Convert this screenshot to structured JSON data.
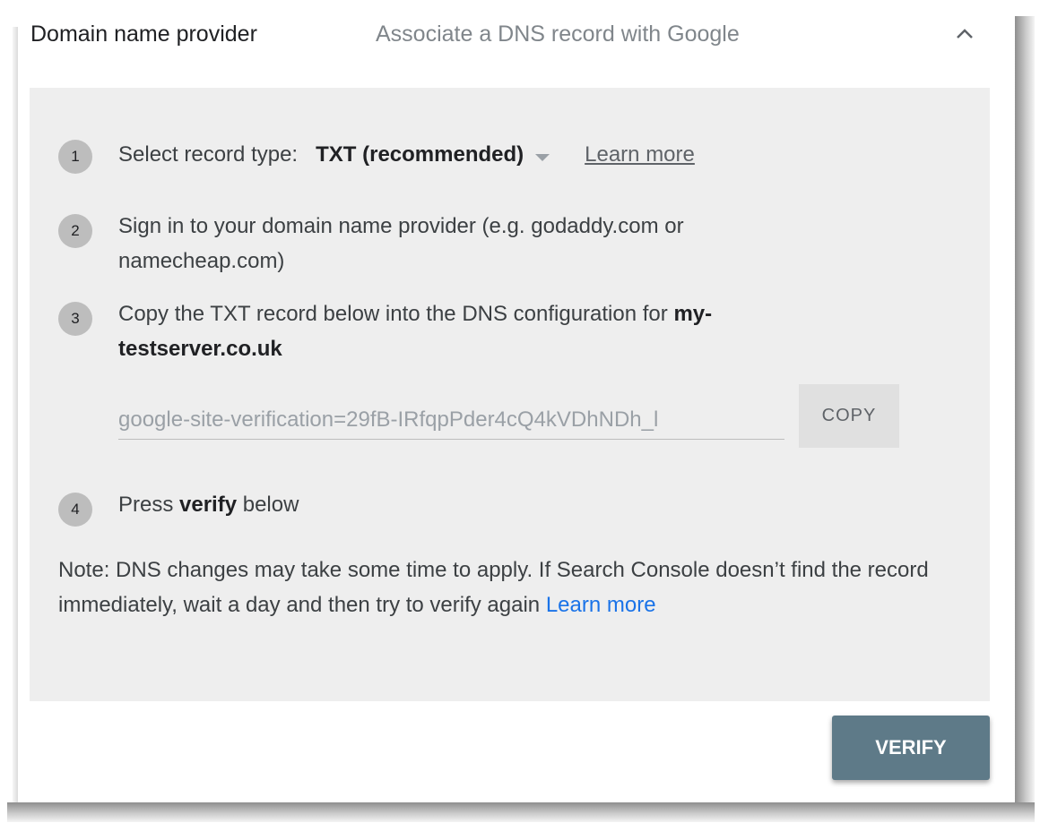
{
  "header": {
    "title": "Domain name provider",
    "subtitle": "Associate a DNS record with Google",
    "collapse_icon": "chevron-up-icon"
  },
  "steps": [
    {
      "number": "1",
      "label": "Select record type:",
      "record_type": "TXT (recommended)",
      "learn_more": "Learn more"
    },
    {
      "number": "2",
      "text": "Sign in to your domain name provider (e.g. godaddy.com or namecheap.com)"
    },
    {
      "number": "3",
      "text": "Copy the TXT record below into the DNS configuration for ",
      "domain": "my-testserver.co.uk"
    },
    {
      "number": "4",
      "text_before": "Press ",
      "text_bold": "verify",
      "text_after": " below"
    }
  ],
  "txt_record": {
    "value": "google-site-verification=29fB-IRfqpPder4cQ4kVDhNDh_l",
    "copy_label": "COPY"
  },
  "note": {
    "text": "Note: DNS changes may take some time to apply. If Search Console doesn’t find the record immediately, wait a day and then try to verify again ",
    "link": "Learn more"
  },
  "verify_label": "VERIFY",
  "colors": {
    "panel_bg": "#eeeeee",
    "verify_bg": "#5e7a88",
    "link_blue": "#1a73e8",
    "step_circle": "#bdbdbd"
  }
}
